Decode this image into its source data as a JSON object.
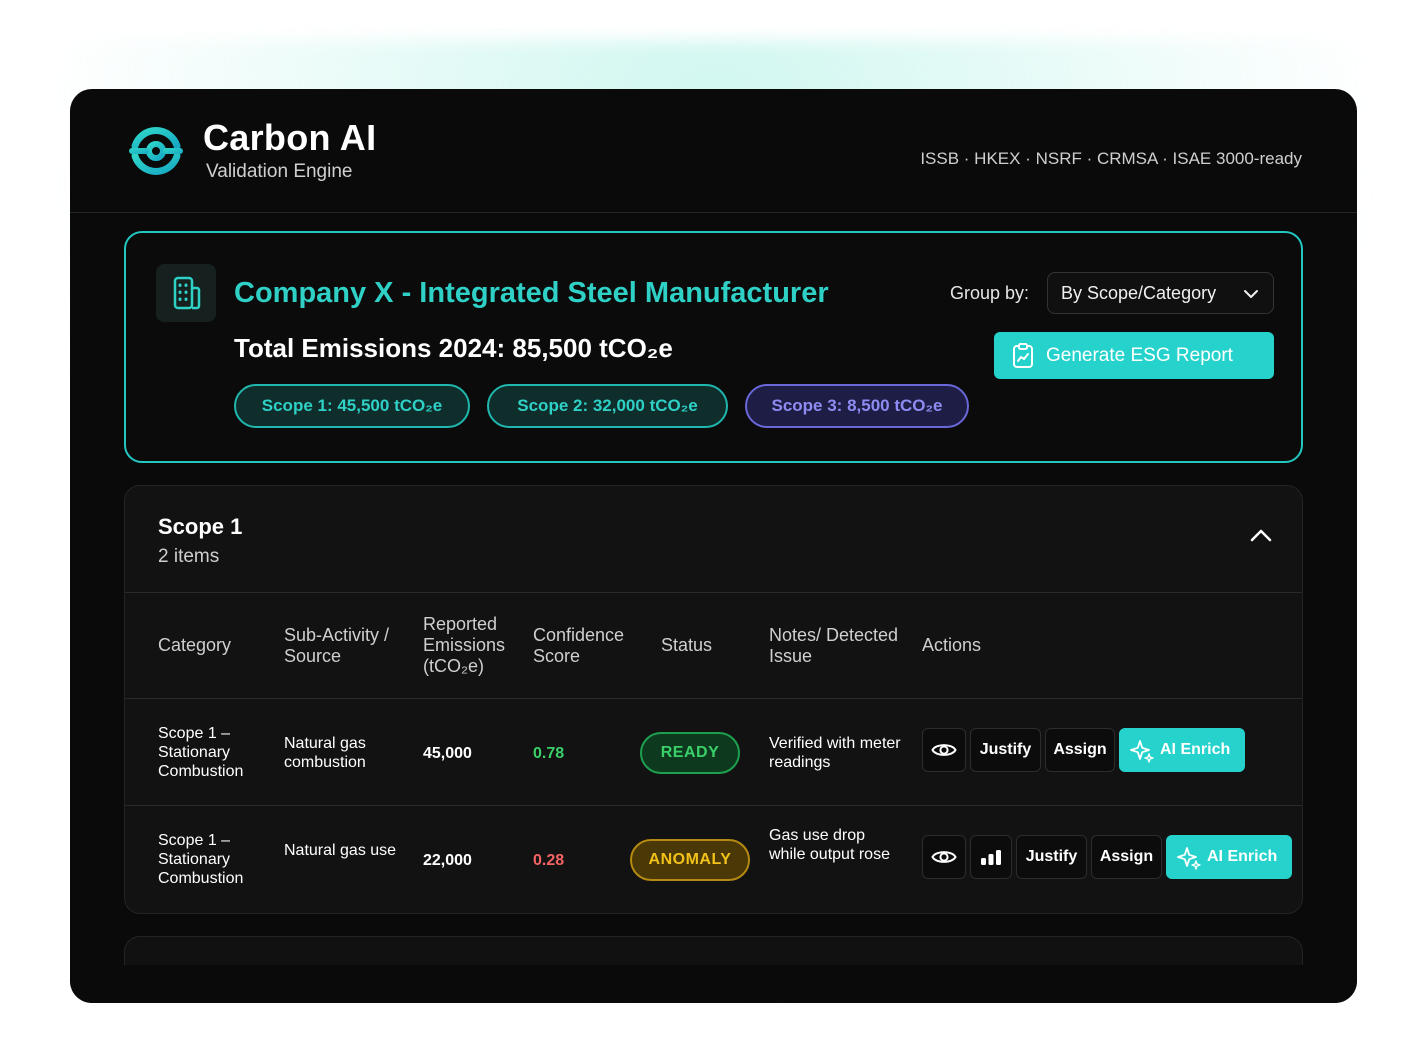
{
  "brand": {
    "title": "Carbon AI",
    "subtitle": "Validation Engine",
    "standards": "ISSB · HKEX · NSRF · CRMSA · ISAE 3000-ready",
    "accent_color": "#26d3cc"
  },
  "company": {
    "name": "Company X - Integrated Steel Manufacturer",
    "total_emissions": "Total Emissions 2024: 85,500 tCO₂e",
    "scope_pills": [
      "Scope 1: 45,500 tCO₂e",
      "Scope 2: 32,000 tCO₂e",
      "Scope 3: 8,500 tCO₂e"
    ],
    "group_by_label": "Group by:",
    "group_by_value": "By Scope/Category",
    "generate_button": "Generate ESG Report"
  },
  "scope_section": {
    "title": "Scope 1",
    "count": "2 items",
    "expanded": true,
    "columns": [
      "Category",
      "Sub-Activity / Source",
      "Reported Emissions (tCO₂e)",
      "Confidence Score",
      "Status",
      "Notes/ Detected Issue",
      "Actions"
    ],
    "rows": [
      {
        "category": "Scope 1 – Stationary Combustion",
        "source": "Natural gas combustion",
        "emissions": "45,000",
        "confidence": "0.78",
        "status": "READY",
        "notes": "Verified with meter readings",
        "actions": {
          "justify": "Justify",
          "assign": "Assign",
          "ai": "AI Enrich"
        }
      },
      {
        "category": "Scope 1 – Stationary Combustion",
        "source": "Natural gas use",
        "emissions": "22,000",
        "confidence": "0.28",
        "status": "ANOMALY",
        "notes": "Gas use drop while output rose",
        "actions": {
          "justify": "Justify",
          "assign": "Assign",
          "ai": "AI Enrich"
        }
      }
    ]
  },
  "icons": [
    "carbon-logo-icon",
    "building-icon",
    "chevron-down-icon",
    "clipboard-icon",
    "chevron-up-icon",
    "eye-icon",
    "bar-chart-icon",
    "sparkle-icon"
  ]
}
